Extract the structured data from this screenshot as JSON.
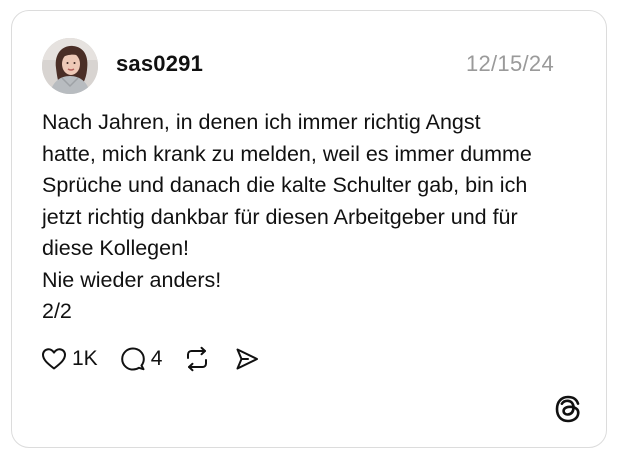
{
  "post": {
    "username": "sas0291",
    "date": "12/15/24",
    "text_lines": [
      "Nach Jahren, in denen ich immer richtig Angst",
      "hatte, mich krank zu melden, weil es immer dumme",
      "Sprüche und danach die kalte Schulter gab, bin ich",
      "jetzt richtig dankbar für diesen Arbeitgeber und für",
      "diese Kollegen!",
      "Nie wieder anders!",
      "2/2"
    ]
  },
  "actions": {
    "like_count": "1K",
    "reply_count": "4",
    "like_icon": "heart-icon",
    "reply_icon": "speech-bubble-icon",
    "repost_icon": "repost-icon",
    "share_icon": "send-icon"
  },
  "branding": {
    "logo_icon": "threads-logo-icon"
  },
  "colors": {
    "text": "#111111",
    "date": "#9a9a9a",
    "border": "#dcdcdc",
    "background": "#ffffff"
  }
}
